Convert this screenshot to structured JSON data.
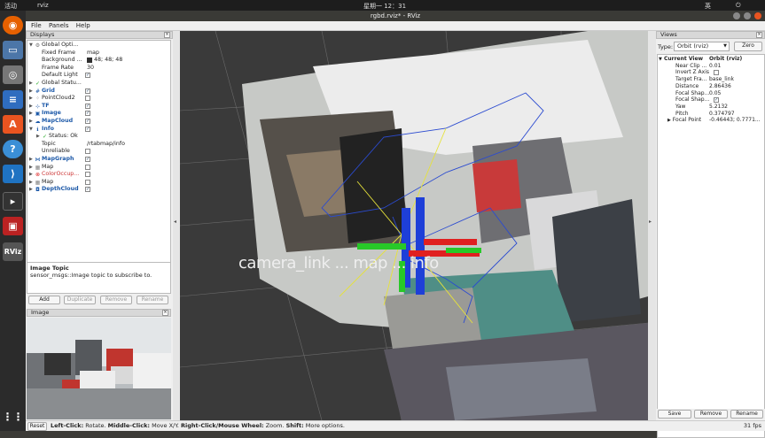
{
  "topbar": {
    "activities": "活动",
    "app_name": "rviz",
    "clock": "星期一 12：31",
    "lang": "英"
  },
  "window": {
    "title": "rgbd.rviz* - RViz"
  },
  "menu": [
    "File",
    "Panels",
    "Help"
  ],
  "displays": {
    "title": "Displays",
    "rows": [
      {
        "label": "Global Opti...",
        "value": "",
        "checked": null
      },
      {
        "label": "Fixed Frame",
        "value": "map",
        "checked": null
      },
      {
        "label": "Background ...",
        "value": "48; 48; 48",
        "checked": null
      },
      {
        "label": "Frame Rate",
        "value": "30",
        "checked": null
      },
      {
        "label": "Default Light",
        "value": "",
        "checked": true
      },
      {
        "label": "Global Statu...",
        "value": "",
        "checked": null
      },
      {
        "label": "Grid",
        "value": "",
        "checked": true
      },
      {
        "label": "PointCloud2",
        "value": "",
        "checked": false
      },
      {
        "label": "TF",
        "value": "",
        "checked": true
      },
      {
        "label": "Image",
        "value": "",
        "checked": true
      },
      {
        "label": "MapCloud",
        "value": "",
        "checked": true
      },
      {
        "label": "Info",
        "value": "",
        "checked": true
      },
      {
        "label": "Status: Ok",
        "value": "",
        "checked": null
      },
      {
        "label": "Topic",
        "value": "/rtabmap/info",
        "checked": null
      },
      {
        "label": "Unreliable",
        "value": "",
        "checked": false
      },
      {
        "label": "MapGraph",
        "value": "",
        "checked": true
      },
      {
        "label": "Map",
        "value": "",
        "checked": false
      },
      {
        "label": "ColorOccup...",
        "value": "",
        "checked": false
      },
      {
        "label": "Map",
        "value": "",
        "checked": false
      },
      {
        "label": "DepthCloud",
        "value": "",
        "checked": true
      }
    ]
  },
  "topic_help": {
    "title": "Image Topic",
    "text": "sensor_msgs::Image topic to subscribe to."
  },
  "display_buttons": {
    "add": "Add",
    "duplicate": "Duplicate",
    "remove": "Remove",
    "rename": "Rename"
  },
  "image_panel": {
    "title": "Image"
  },
  "viewport": {
    "overlay_text": "camera_link ... map ... info"
  },
  "views": {
    "title": "Views",
    "type_label": "Type:",
    "type_value": "Orbit (rviz)",
    "zero": "Zero",
    "rows": [
      {
        "k": "Current View",
        "v": "Orbit (rviz)"
      },
      {
        "k": "Near Clip ...",
        "v": "0.01"
      },
      {
        "k": "Invert Z Axis",
        "v": ""
      },
      {
        "k": "Target Fra...",
        "v": "base_link"
      },
      {
        "k": "Distance",
        "v": "2.86436"
      },
      {
        "k": "Focal Shap...",
        "v": "0.05"
      },
      {
        "k": "Focal Shap...",
        "v": "✓"
      },
      {
        "k": "Yaw",
        "v": "5.2132"
      },
      {
        "k": "Pitch",
        "v": "0.374797"
      },
      {
        "k": "Focal Point",
        "v": "-0.46443; 0.7771..."
      }
    ],
    "save": "Save",
    "remove": "Remove",
    "rename": "Rename"
  },
  "status": {
    "reset": "Reset",
    "hint_bold1": "Left-Click:",
    "hint1": " Rotate. ",
    "hint_bold2": "Middle-Click:",
    "hint2": " Move X/Y. ",
    "hint_bold3": "Right-Click/Mouse Wheel:",
    "hint3": " Zoom. ",
    "hint_bold4": "Shift:",
    "hint4": " More options.",
    "fps": "31 fps"
  }
}
